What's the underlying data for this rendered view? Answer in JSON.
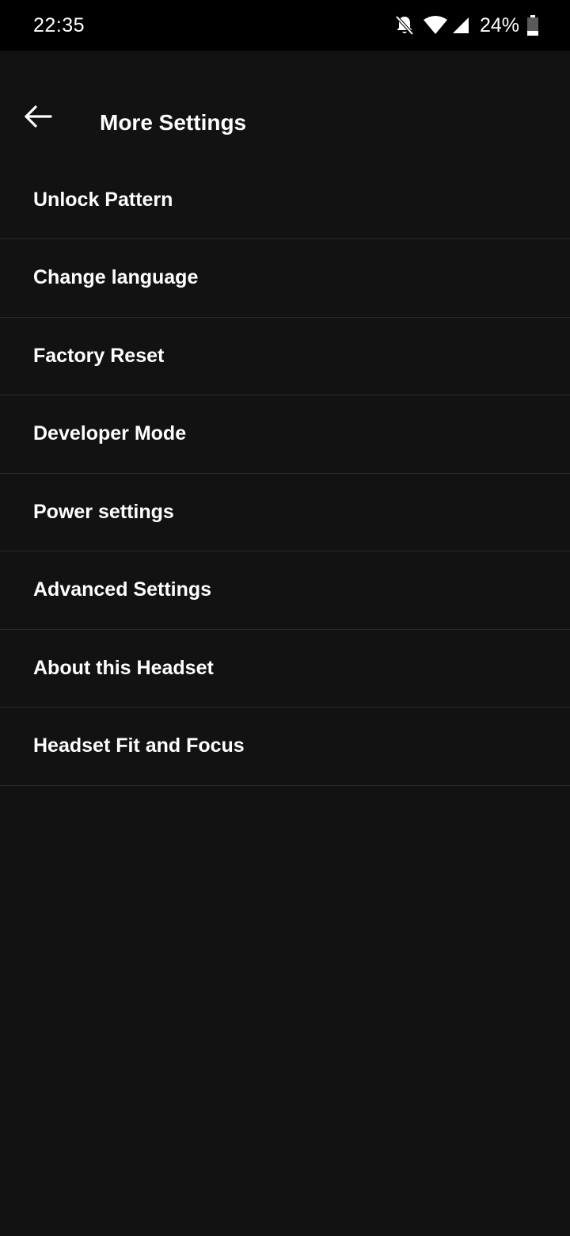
{
  "status_bar": {
    "time": "22:35",
    "battery_percent": "24%",
    "icons": [
      "bell-muted-icon",
      "wifi-icon",
      "signal-icon",
      "battery-icon"
    ],
    "battery_level": 0.24
  },
  "header": {
    "back_icon": "arrow-left-icon",
    "title": "More Settings"
  },
  "settings": {
    "items": [
      {
        "label": "Unlock Pattern"
      },
      {
        "label": "Change language"
      },
      {
        "label": "Factory Reset"
      },
      {
        "label": "Developer Mode"
      },
      {
        "label": "Power settings"
      },
      {
        "label": "Advanced Settings"
      },
      {
        "label": "About this Headset"
      },
      {
        "label": "Headset Fit and Focus"
      }
    ]
  },
  "colors": {
    "background": "#121212",
    "status_bar": "#000000",
    "text": "#ffffff",
    "divider": "#2a2a2a"
  }
}
